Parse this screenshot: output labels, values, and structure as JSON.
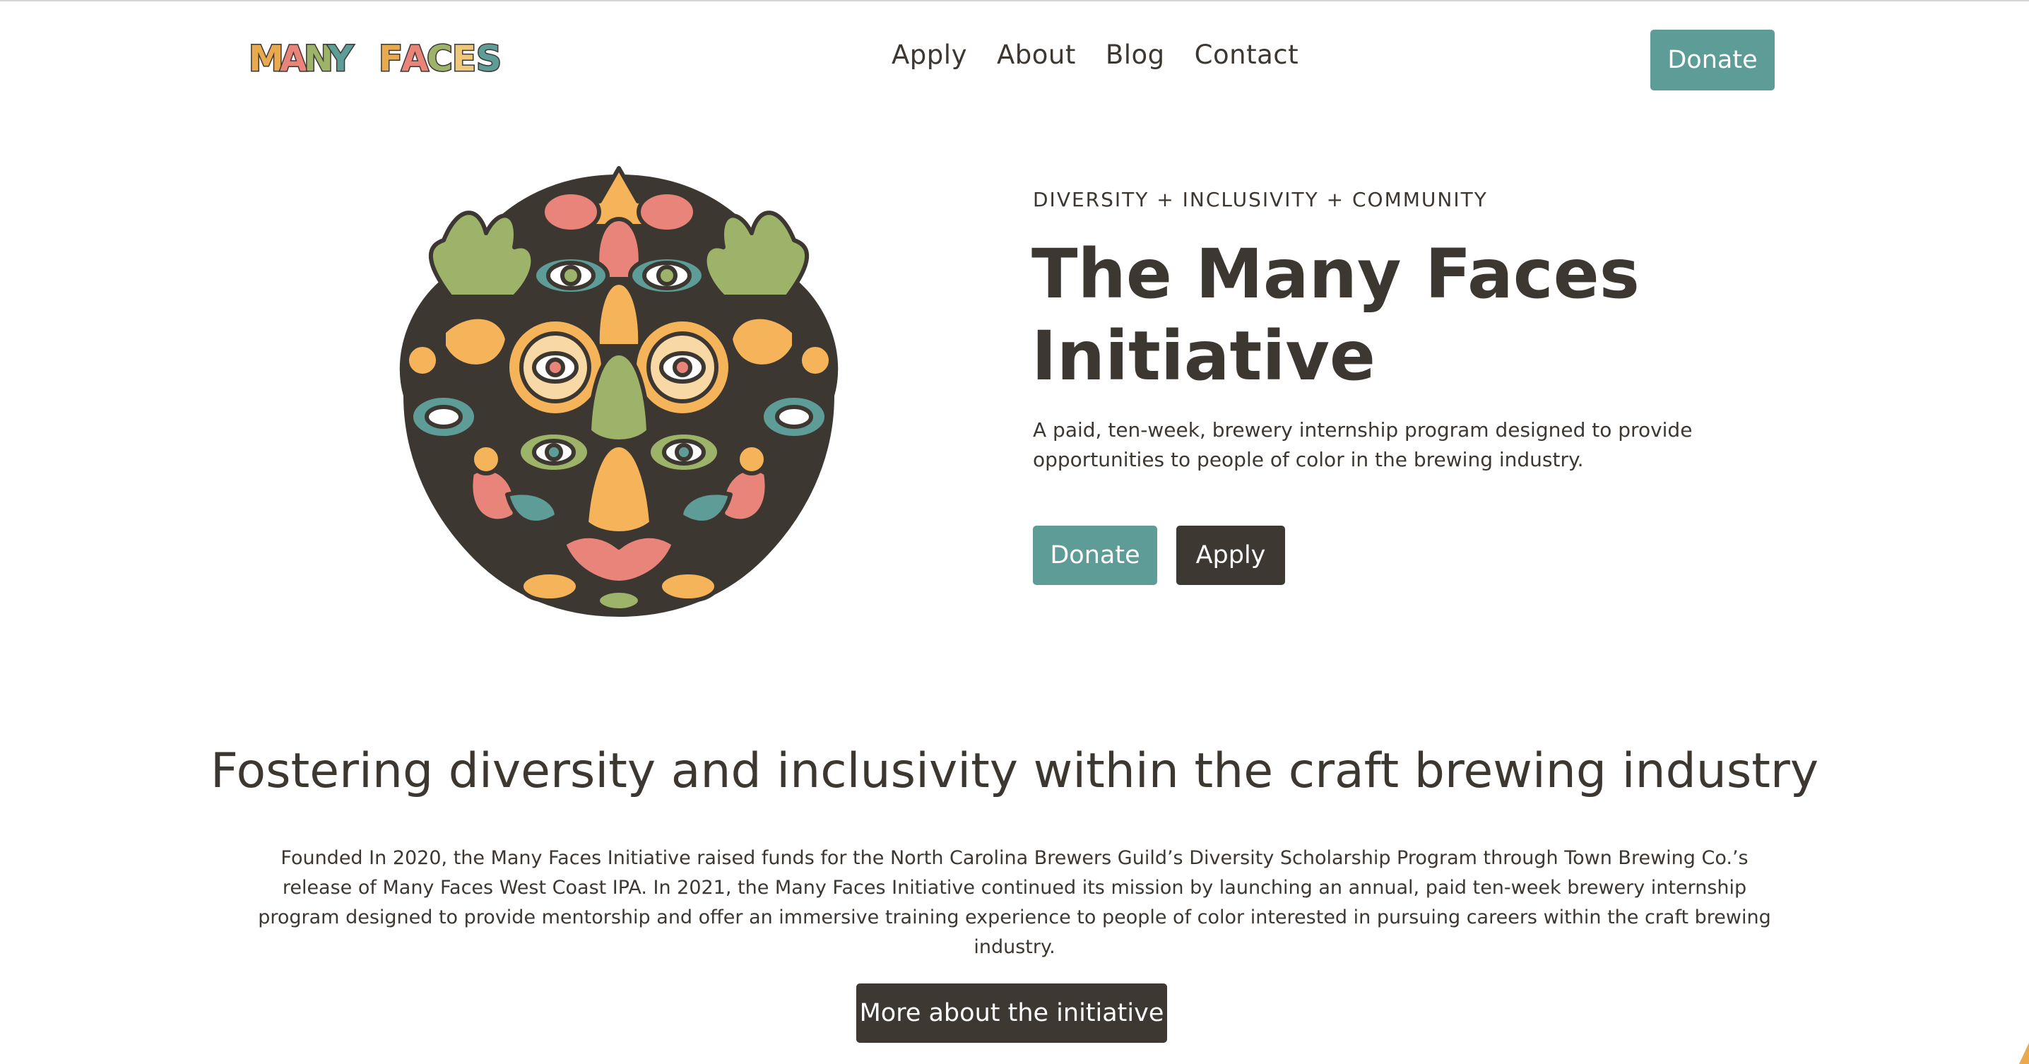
{
  "header": {
    "logo_text": "MANY FACES",
    "nav": [
      "Apply",
      "About",
      "Blog",
      "Contact"
    ],
    "donate_label": "Donate"
  },
  "hero": {
    "eyebrow": "DIVERSITY + INCLUSIVITY + COMMUNITY",
    "title": "The Many Faces Initiative",
    "description": "A paid, ten-week, brewery internship program designed to provide opportunities to people of color in the brewing industry.",
    "donate_label": "Donate",
    "apply_label": "Apply",
    "art_icon": "many-faces-illustration"
  },
  "section": {
    "title": "Fostering diversity and inclusivity within the craft brewing industry",
    "body": "Founded In 2020, the Many Faces Initiative raised funds for the North Carolina Brewers Guild’s Diversity Scholarship Program through Town Brewing Co.’s release of Many Faces West Coast IPA. In 2021, the Many Faces Initiative continued its mission by launching an annual, paid ten-week brewery internship program designed to provide mentorship and offer an immersive training experience to people of color interested in pursuing careers within the craft brewing industry.",
    "cta_label": "More about the initiative"
  },
  "colors": {
    "teal": "#5e9c98",
    "dark": "#3e3833",
    "text": "#3d3732",
    "orange": "#f5b45a",
    "pink": "#e9847a",
    "green": "#9db36a",
    "cream": "#f8d9a6"
  }
}
